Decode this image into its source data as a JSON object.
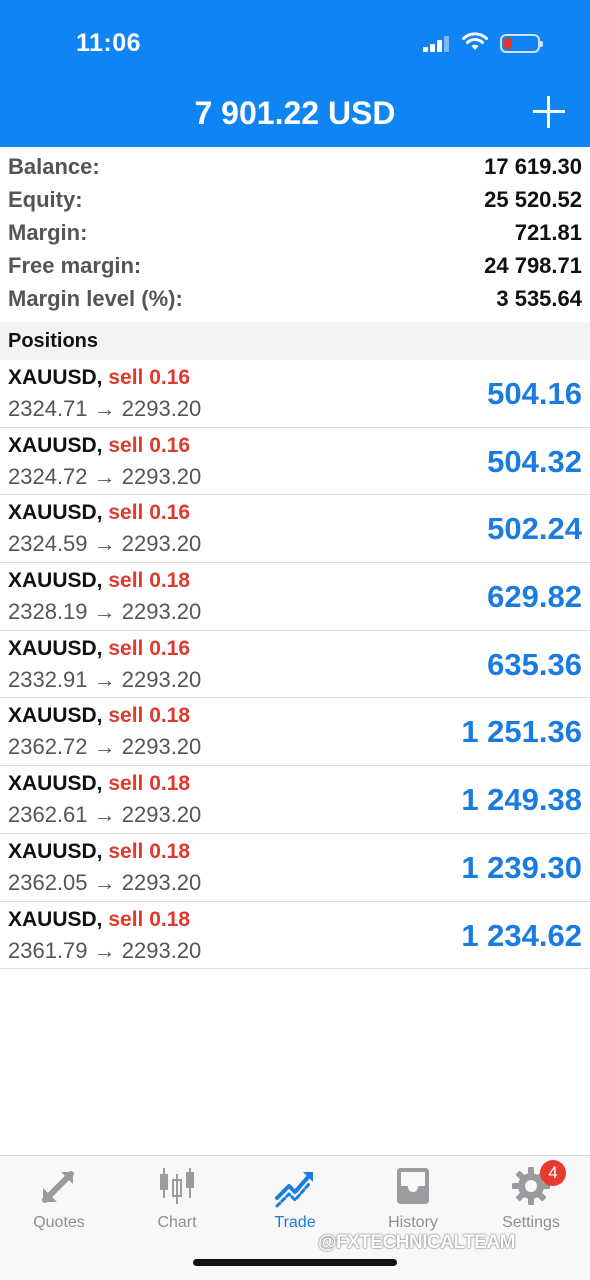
{
  "status_bar": {
    "time": "11:06"
  },
  "header": {
    "title": "7 901.22 USD"
  },
  "summary": [
    {
      "label": "Balance:",
      "value": "17 619.30"
    },
    {
      "label": "Equity:",
      "value": "25 520.52"
    },
    {
      "label": "Margin:",
      "value": "721.81"
    },
    {
      "label": "Free margin:",
      "value": "24 798.71"
    },
    {
      "label": "Margin level (%):",
      "value": "3 535.64"
    }
  ],
  "positions_header": "Positions",
  "positions": [
    {
      "symbol": "XAUUSD,",
      "side": "sell 0.16",
      "prices": "2324.71 → 2293.20",
      "profit": "504.16"
    },
    {
      "symbol": "XAUUSD,",
      "side": "sell 0.16",
      "prices": "2324.72 → 2293.20",
      "profit": "504.32"
    },
    {
      "symbol": "XAUUSD,",
      "side": "sell 0.16",
      "prices": "2324.59 → 2293.20",
      "profit": "502.24"
    },
    {
      "symbol": "XAUUSD,",
      "side": "sell 0.18",
      "prices": "2328.19 → 2293.20",
      "profit": "629.82"
    },
    {
      "symbol": "XAUUSD,",
      "side": "sell 0.16",
      "prices": "2332.91 → 2293.20",
      "profit": "635.36"
    },
    {
      "symbol": "XAUUSD,",
      "side": "sell 0.18",
      "prices": "2362.72 → 2293.20",
      "profit": "1 251.36"
    },
    {
      "symbol": "XAUUSD,",
      "side": "sell 0.18",
      "prices": "2362.61 → 2293.20",
      "profit": "1 249.38"
    },
    {
      "symbol": "XAUUSD,",
      "side": "sell 0.18",
      "prices": "2362.05 → 2293.20",
      "profit": "1 239.30"
    },
    {
      "symbol": "XAUUSD,",
      "side": "sell 0.18",
      "prices": "2361.79 → 2293.20",
      "profit": "1 234.62"
    }
  ],
  "tabs": [
    {
      "label": "Quotes",
      "icon": "quotes-arrows-icon"
    },
    {
      "label": "Chart",
      "icon": "candlestick-chart-icon"
    },
    {
      "label": "Trade",
      "icon": "trade-trend-icon",
      "active": true
    },
    {
      "label": "History",
      "icon": "inbox-history-icon"
    },
    {
      "label": "Settings",
      "icon": "gear-icon",
      "badge": "4"
    }
  ],
  "watermark": "@FXTECHNICALTEAM",
  "colors": {
    "header_bg": "#0f84f4",
    "profit_blue": "#1a7be0",
    "sell_red": "#e03a2c",
    "badge_red": "#ea3a2f"
  }
}
